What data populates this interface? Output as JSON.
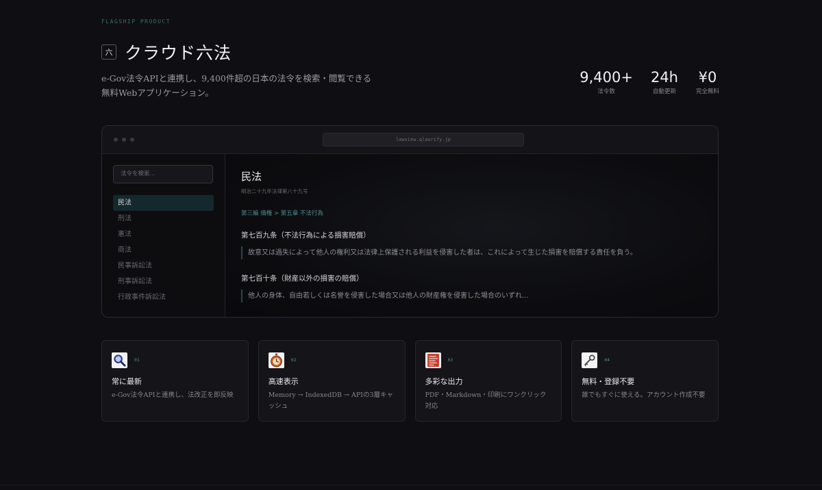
{
  "hero": {
    "eyebrow": "FLAGSHIP PRODUCT",
    "logo_glyph": "六",
    "title": "クラウド六法",
    "description": "e-Gov法令APIと連携し、9,400件超の日本の法令を検索・閲覧できる無料Webアプリケーション。",
    "stats": [
      {
        "value": "9,400+",
        "label": "法令数"
      },
      {
        "value": "24h",
        "label": "自動更新"
      },
      {
        "value": "¥0",
        "label": "完全無料"
      }
    ]
  },
  "browser": {
    "url": "lawview.qlaurify.jp",
    "search_placeholder": "法令を検索...",
    "nav_items": [
      "民法",
      "刑法",
      "憲法",
      "商法",
      "民事訴訟法",
      "刑事訴訟法",
      "行政事件訴訟法"
    ],
    "active_index": 0,
    "law": {
      "title": "民法",
      "subtitle": "明治二十九年法律第八十九号",
      "breadcrumb": "第三編 債権 > 第五章 不法行為",
      "articles": [
        {
          "title": "第七百九条（不法行為による損害賠償）",
          "body": "故意又は過失によって他人の権利又は法律上保護される利益を侵害した者は、これによって生じた損害を賠償する責任を負う。"
        },
        {
          "title": "第七百十条（財産以外の損害の賠償）",
          "body": "他人の身体、自由若しくは名誉を侵害した場合又は他人の財産権を侵害した場合のいずれ..."
        }
      ]
    }
  },
  "features": [
    {
      "icon": "magnifier-icon",
      "num": "01",
      "title": "常に最新",
      "desc": "e-Gov法令APIと連携し、法改正を即反映"
    },
    {
      "icon": "stopwatch-icon",
      "num": "02",
      "title": "高速表示",
      "desc": "Memory → IndexedDB → APIの3層キャッシュ"
    },
    {
      "icon": "document-icon",
      "num": "03",
      "title": "多彩な出力",
      "desc": "PDF・Markdown・印刷にワンクリック対応"
    },
    {
      "icon": "key-icon",
      "num": "04",
      "title": "無料・登録不要",
      "desc": "誰でもすぐに使える。アカウント作成不要"
    }
  ],
  "colors": {
    "background": "#0f0f13",
    "accent": "#4f8d8e",
    "active_nav": "#13292d"
  }
}
